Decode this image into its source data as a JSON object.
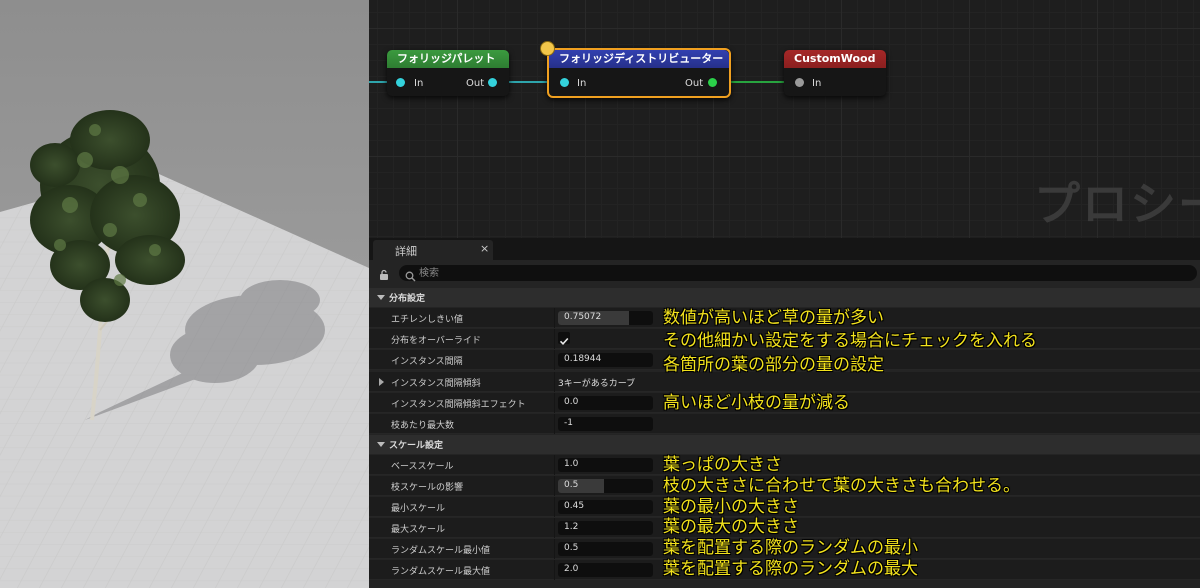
{
  "graph": {
    "nodes": {
      "palette": {
        "title": "フォリッジパレット",
        "in": "In",
        "out": "Out"
      },
      "distributor": {
        "title": "フォリッジディストリビューター",
        "in": "In",
        "out": "Out"
      },
      "custom": {
        "title": "CustomWood",
        "in": "In"
      }
    },
    "watermark": "プロシー",
    "colors": {
      "palette_header": "#2e7d32",
      "distributor_header": "#26308a",
      "custom_header": "#8b1f1f",
      "selection": "#f0a020",
      "pin_cyan": "#34d2dc",
      "pin_green": "#2bd14a",
      "pin_gray": "#9a9a9a"
    }
  },
  "details": {
    "tab": {
      "label": "詳細",
      "close": "×"
    },
    "search": {
      "placeholder": "検索"
    },
    "categories": {
      "distribution": "分布設定",
      "scale": "スケール設定"
    },
    "rows": {
      "threshold": {
        "label": "エチレンしきい値",
        "value": "0.75072",
        "fill": 0.75
      },
      "override": {
        "label": "分布をオーバーライド",
        "checked": true
      },
      "spacing": {
        "label": "インスタンス間隔",
        "value": "0.18944"
      },
      "slope": {
        "label": "インスタンス間隔傾斜",
        "value": "3キーがあるカーブ"
      },
      "slope_effect": {
        "label": "インスタンス間隔傾斜エフェクト",
        "value": "0.0"
      },
      "max_per_branch": {
        "label": "枝あたり最大数",
        "value": "-1"
      },
      "base_scale": {
        "label": "ベーススケール",
        "value": "1.0"
      },
      "branch_scale": {
        "label": "枝スケールの影響",
        "value": "0.5",
        "fill": 0.5
      },
      "min_scale": {
        "label": "最小スケール",
        "value": "0.45"
      },
      "max_scale": {
        "label": "最大スケール",
        "value": "1.2"
      },
      "rand_min": {
        "label": "ランダムスケール最小値",
        "value": "0.5"
      },
      "rand_max": {
        "label": "ランダムスケール最大値",
        "value": "2.0"
      }
    }
  },
  "annotations": {
    "threshold": "数値が高いほど草の量が多い",
    "override": "その他細かい設定をする場合にチェックを入れる",
    "spacing": "各箇所の葉の部分の量の設定",
    "slope_effect": "高いほど小枝の量が減る",
    "base_scale": "葉っぱの大きさ",
    "branch_scale": "枝の大きさに合わせて葉の大きさも合わせる。",
    "min_scale": "葉の最小の大きさ",
    "max_scale": "葉の最大の大きさ",
    "rand_min": "葉を配置する際のランダムの最小",
    "rand_max": "葉を配置する際のランダムの最大"
  }
}
